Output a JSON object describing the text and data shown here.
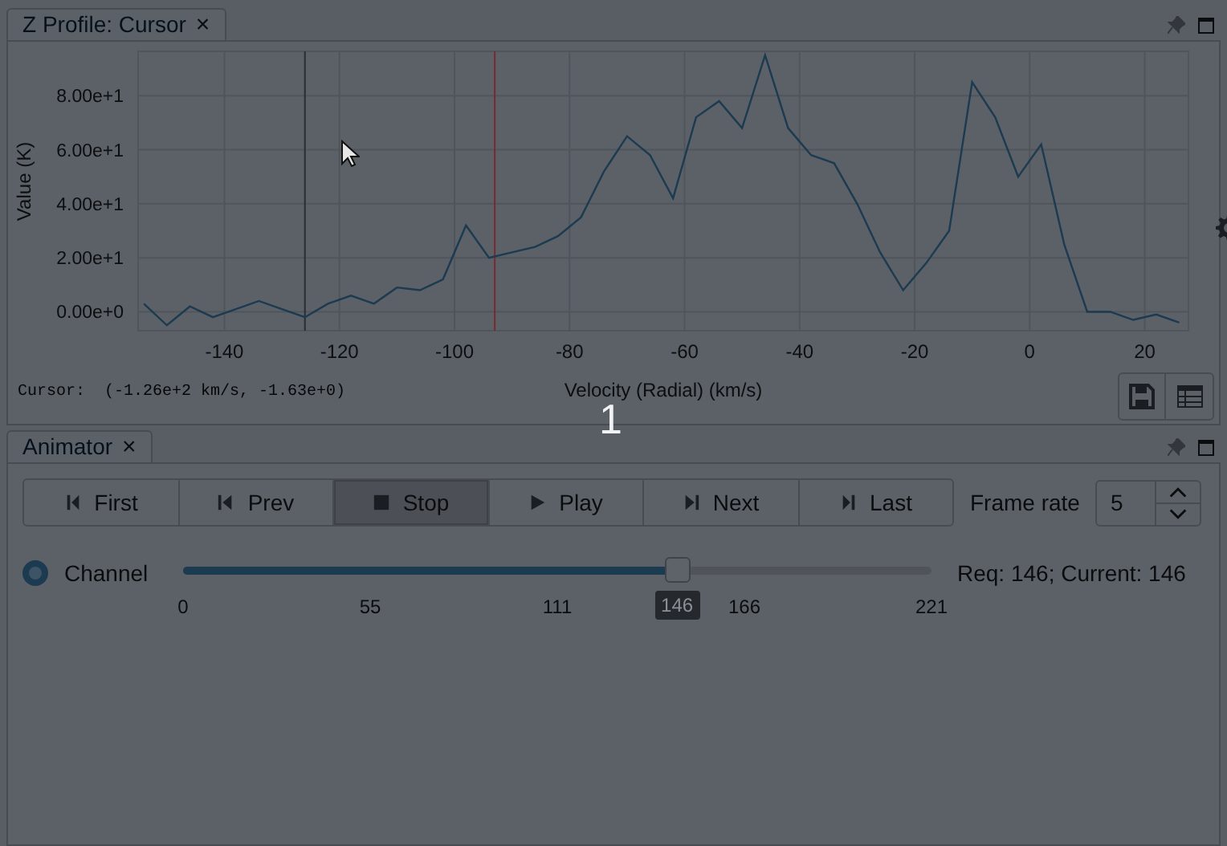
{
  "profile_panel": {
    "tab": {
      "label": "Z Profile: Cursor",
      "close": "×"
    },
    "chart_data": {
      "type": "line",
      "xlabel": "Velocity (Radial) (km/s)",
      "ylabel": "Value (K)",
      "x": [
        -154,
        -150,
        -146,
        -142,
        -138,
        -134,
        -130,
        -126,
        -122,
        -118,
        -114,
        -110,
        -106,
        -102,
        -98,
        -94,
        -90,
        -86,
        -82,
        -78,
        -74,
        -70,
        -66,
        -62,
        -58,
        -54,
        -50,
        -46,
        -42,
        -38,
        -34,
        -30,
        -26,
        -22,
        -18,
        -14,
        -10,
        -6,
        -2,
        2,
        6,
        10,
        14,
        18,
        22,
        26
      ],
      "series": [
        {
          "color": "#1c3a50",
          "values": [
            3,
            -5,
            2,
            -2,
            1,
            4,
            1,
            -2,
            3,
            6,
            3,
            9,
            8,
            12,
            32,
            20,
            22,
            24,
            28,
            35,
            52,
            65,
            58,
            42,
            72,
            78,
            68,
            95,
            68,
            58,
            55,
            40,
            22,
            8,
            18,
            30,
            85,
            72,
            50,
            62,
            25,
            0,
            0,
            -3,
            -1,
            -4
          ]
        }
      ],
      "xlim": [
        -155,
        27.6
      ],
      "ylim": [
        -7,
        96.4
      ],
      "xticks": [
        -140,
        -120,
        -100,
        -80,
        -60,
        -40,
        -20,
        0,
        20
      ],
      "yticks": [
        {
          "value": 0,
          "label": "0.00e+0"
        },
        {
          "value": 20,
          "label": "2.00e+1"
        },
        {
          "value": 40,
          "label": "4.00e+1"
        },
        {
          "value": 60,
          "label": "6.00e+1"
        },
        {
          "value": 80,
          "label": "8.00e+1"
        }
      ],
      "grid": true,
      "ref_lines": [
        {
          "axis": "x",
          "value": -126,
          "color": "#2a2e33"
        },
        {
          "axis": "x",
          "value": -93,
          "color": "#7a2a2a"
        }
      ]
    },
    "cursor_readout": "Cursor:  (-1.26e+2 km/s, -1.63e+0)"
  },
  "animator_panel": {
    "tab": {
      "label": "Animator",
      "close": "×"
    },
    "buttons": [
      {
        "label": "First",
        "selected": false
      },
      {
        "label": "Prev",
        "selected": false
      },
      {
        "label": "Stop",
        "selected": true
      },
      {
        "label": "Play",
        "selected": false
      },
      {
        "label": "Next",
        "selected": false
      },
      {
        "label": "Last",
        "selected": false
      }
    ],
    "frame_rate": {
      "label": "Frame rate",
      "value": "5"
    },
    "channel": {
      "label": "Channel",
      "selected": true,
      "level": 0.66,
      "value_label": "146",
      "ticks": [
        "0",
        "55",
        "111",
        "166",
        "221"
      ],
      "status": "Req: 146; Current: 146"
    }
  },
  "overlay_text": "1"
}
